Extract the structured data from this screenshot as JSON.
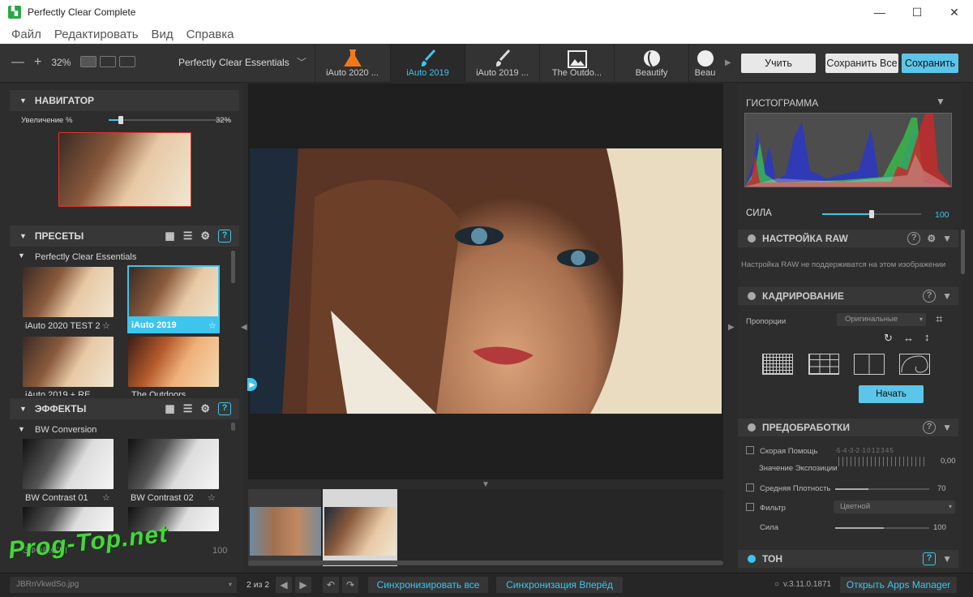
{
  "window": {
    "title": "Perfectly Clear Complete",
    "controls": [
      "—",
      "☐",
      "✕"
    ]
  },
  "menu": [
    "Файл",
    "Редактировать",
    "Вид",
    "Справка"
  ],
  "toolbar": {
    "zoom_minus": "—",
    "zoom_plus": "+",
    "zoom_value": "32%",
    "preset_group": "Perfectly Clear Essentials",
    "preset_tabs": [
      {
        "label": "iAuto 2020 ...",
        "icon": "flask-icon",
        "active": false
      },
      {
        "label": "iAuto 2019",
        "icon": "brush-icon",
        "active": true
      },
      {
        "label": "iAuto 2019 ...",
        "icon": "brush-icon",
        "active": false
      },
      {
        "label": "The Outdo...",
        "icon": "landscape-icon",
        "active": false
      },
      {
        "label": "Beautify",
        "icon": "face-icon",
        "active": false
      },
      {
        "label": "Beau",
        "icon": "face-icon",
        "active": false
      }
    ],
    "learn_button": "Учить",
    "save_all_button": "Сохранить Все",
    "save_button": "Сохранить"
  },
  "navigator": {
    "title": "НАВИГАТОР",
    "zoom_label": "Увеличение %",
    "zoom_value": "32%",
    "zoom_percent": 32
  },
  "presets": {
    "title": "ПРЕСЕТЫ",
    "group": "Perfectly Clear Essentials",
    "items": [
      {
        "label": "iAuto 2020 TEST 2",
        "selected": false
      },
      {
        "label": "iAuto 2019",
        "selected": true
      },
      {
        "label": "iAuto 2019 + RE",
        "selected": false
      },
      {
        "label": "The Outdoors",
        "selected": false
      }
    ]
  },
  "effects": {
    "title": "ЭФФЕКТЫ",
    "group": "BW Conversion",
    "items": [
      {
        "label": "BW Contrast 01"
      },
      {
        "label": "BW Contrast 02"
      }
    ],
    "strength_label": "ЭФФЕКТЫ",
    "strength_value": "100"
  },
  "histogram": {
    "title": "ГИСТОГРАММА",
    "strength_label": "СИЛА",
    "strength_value": "100",
    "strength_fraction": 0.5
  },
  "raw": {
    "title": "НАСТРОЙКА RAW",
    "message": "Настройка RAW не поддерживатся на этом изображении"
  },
  "crop": {
    "title": "КАДРИРОВАНИЕ",
    "ratio_label": "Пропорции",
    "ratio_value": "Оригинальные",
    "start_button": "Начать"
  },
  "pre": {
    "title": "ПРЕДОБРАБОТКИ",
    "quick_help": "Скорая Помощь",
    "exposure_label": "Значение Экспозиции",
    "exposure_scale": "-5 -4 -3 -2 -1  0  1  2  3  4  5",
    "exposure_value": "0,00",
    "density_label": "Средняя Плотность",
    "density_value": "70",
    "filter_label": "Фильтр",
    "filter_value": "Цветной",
    "strength_label": "Сила",
    "strength_value": "100"
  },
  "tone": {
    "title": "ТОН"
  },
  "status": {
    "filename": "JBRnVkwdSo.jpg",
    "page": "2 из 2",
    "sync_all": "Синхронизировать все",
    "sync_forward": "Синхронизация Вперёд",
    "version": "v.3.11.0.1871",
    "apps_manager": "Открыть Apps Manager"
  },
  "watermark": "Prog-Top.net",
  "colors": {
    "accent": "#3ec5ee",
    "panel": "#2d2d2d",
    "header": "#373737"
  }
}
